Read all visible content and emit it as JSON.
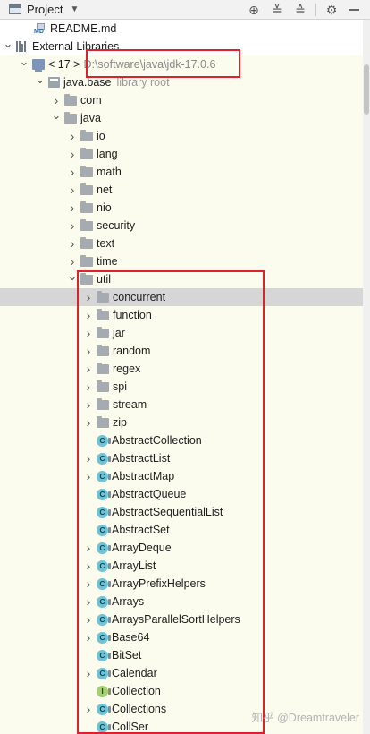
{
  "header": {
    "title": "Project",
    "icons": [
      "project-icon",
      "locate-icon",
      "expand-all-icon",
      "collapse-all-icon",
      "gear-icon",
      "hide-icon"
    ]
  },
  "tree": {
    "readme": "README.md",
    "external_libraries": "External Libraries",
    "jdk_label": "< 17 >",
    "jdk_path": "D:\\software\\java\\jdk-17.0.6",
    "module": "java.base",
    "module_hint": "library root",
    "com": "com",
    "java": "java",
    "java_children": [
      "io",
      "lang",
      "math",
      "net",
      "nio",
      "security",
      "text",
      "time"
    ],
    "util": "util",
    "util_folders": [
      "concurrent",
      "function",
      "jar",
      "random",
      "regex",
      "spi",
      "stream",
      "zip"
    ],
    "classes": [
      {
        "name": "AbstractCollection",
        "kind": "class",
        "expandable": false
      },
      {
        "name": "AbstractList",
        "kind": "class",
        "expandable": true
      },
      {
        "name": "AbstractMap",
        "kind": "class",
        "expandable": true
      },
      {
        "name": "AbstractQueue",
        "kind": "class",
        "expandable": false
      },
      {
        "name": "AbstractSequentialList",
        "kind": "class",
        "expandable": false
      },
      {
        "name": "AbstractSet",
        "kind": "class",
        "expandable": false
      },
      {
        "name": "ArrayDeque",
        "kind": "class",
        "expandable": true
      },
      {
        "name": "ArrayList",
        "kind": "class",
        "expandable": true
      },
      {
        "name": "ArrayPrefixHelpers",
        "kind": "class",
        "expandable": true
      },
      {
        "name": "Arrays",
        "kind": "class",
        "expandable": true
      },
      {
        "name": "ArraysParallelSortHelpers",
        "kind": "class",
        "expandable": true
      },
      {
        "name": "Base64",
        "kind": "class",
        "expandable": true
      },
      {
        "name": "BitSet",
        "kind": "class",
        "expandable": false
      },
      {
        "name": "Calendar",
        "kind": "class",
        "expandable": true
      },
      {
        "name": "Collection",
        "kind": "interface",
        "expandable": false
      },
      {
        "name": "Collections",
        "kind": "class",
        "expandable": true
      },
      {
        "name": "CollSer",
        "kind": "class",
        "expandable": false
      }
    ]
  },
  "watermark": "知乎 @Dreamtraveler",
  "colors": {
    "highlight_frame": "#e0202a",
    "selected_row": "#d6d6d6",
    "class_icon": "#6ec4d6",
    "interface_icon": "#a5cf73"
  }
}
